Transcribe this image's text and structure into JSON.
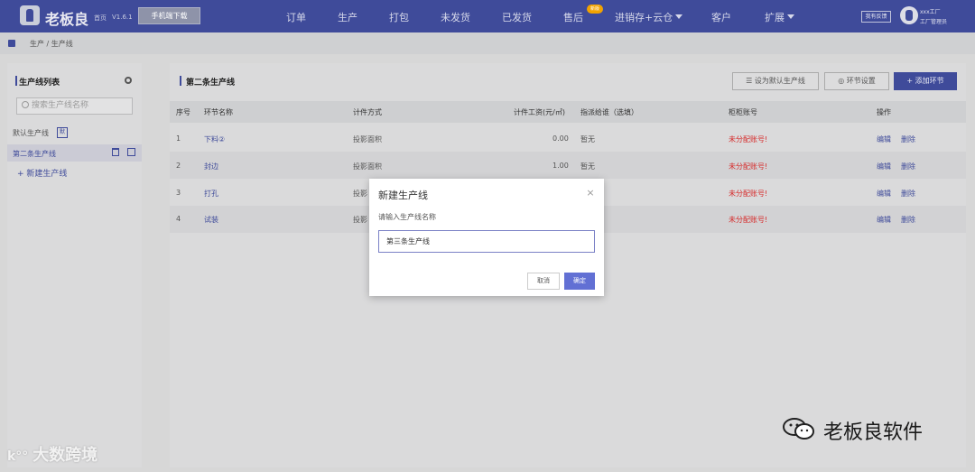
{
  "topbar": {
    "brand": "老板良",
    "home_link": "首页",
    "version": "V1.6.1",
    "mobile_download": "手机端下载",
    "nav": [
      "订单",
      "生产",
      "打包",
      "未发货",
      "已发货",
      "售后",
      "进销存+云仓",
      "客户",
      "扩展"
    ],
    "after_sales_badge": "新版",
    "feedback": "我有反馈",
    "factory_name": "xxx工厂",
    "factory_role": "工厂管理员"
  },
  "breadcrumb": "生产 / 生产线",
  "sidebar": {
    "title": "生产线列表",
    "search_placeholder": "搜索生产线名称",
    "default_label": "默认生产线",
    "default_tag": "默",
    "active_line": "第二条生产线",
    "new_line": "+ 新建生产线"
  },
  "main": {
    "title": "第二条生产线",
    "set_default": "设为默认生产线",
    "step_settings": "环节设置",
    "add_step": "添加环节",
    "columns": [
      "序号",
      "环节名称",
      "计件方式",
      "计件工资(元/㎡)",
      "指派给谁（选填）",
      "柜柜账号",
      "操作"
    ],
    "rows": [
      {
        "no": "1",
        "name": "下料②",
        "method": "投影面积",
        "wage": "0.00",
        "assignee": "暂无",
        "account": "未分配账号!",
        "edit": "编辑",
        "delete": "删除"
      },
      {
        "no": "2",
        "name": "封边",
        "method": "投影面积",
        "wage": "1.00",
        "assignee": "暂无",
        "account": "未分配账号!",
        "edit": "编辑",
        "delete": "删除"
      },
      {
        "no": "3",
        "name": "打孔",
        "method": "投影",
        "wage": "",
        "assignee": "",
        "account": "未分配账号!",
        "edit": "编辑",
        "delete": "删除"
      },
      {
        "no": "4",
        "name": "试装",
        "method": "投影",
        "wage": "",
        "assignee": "",
        "account": "未分配账号!",
        "edit": "编辑",
        "delete": "删除"
      }
    ]
  },
  "dialog": {
    "title": "新建生产线",
    "close": "×",
    "label": "请输入生产线名称",
    "value": "第三条生产线",
    "cancel": "取消",
    "ok": "确定"
  },
  "watermark": {
    "left": "大数跨境",
    "right": "老板良软件"
  },
  "colors": {
    "primary": "#3f4b9a",
    "danger": "#d62a2a",
    "dialog_ok": "#6270d4"
  }
}
